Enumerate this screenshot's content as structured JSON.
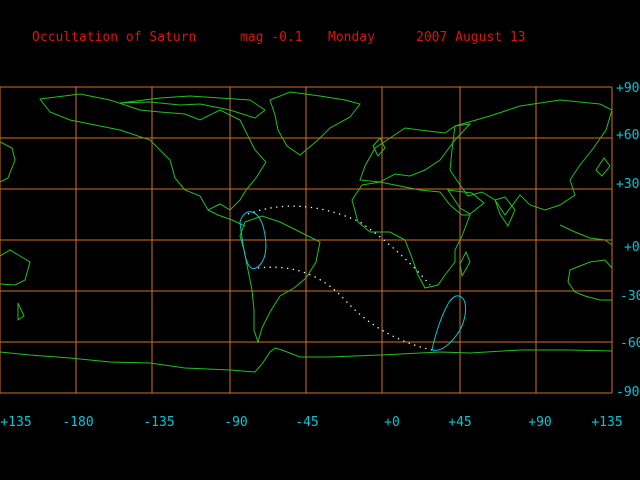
{
  "header": {
    "title": "Occultation of Saturn",
    "magnitude": "mag -0.1",
    "weekday": "Monday",
    "date": "2007 August 13"
  },
  "colors": {
    "background": "#000000",
    "grid": "#d07020",
    "coastline": "#20c020",
    "title": "#e01010",
    "labels": "#00c8d8",
    "limit_curves": "#00c8d8",
    "track": "#ffffff"
  },
  "map": {
    "projection": "equirectangular",
    "lon_range": [
      -180,
      180
    ],
    "lat_range": [
      -90,
      90
    ],
    "lat_labels": [
      "+90",
      "+60",
      "+30",
      "+0",
      "-30",
      "-60",
      "-90"
    ],
    "lon_labels": [
      "+135",
      "-180",
      "-135",
      "-90",
      "-45",
      "+0",
      "+45",
      "+90",
      "+135"
    ]
  }
}
